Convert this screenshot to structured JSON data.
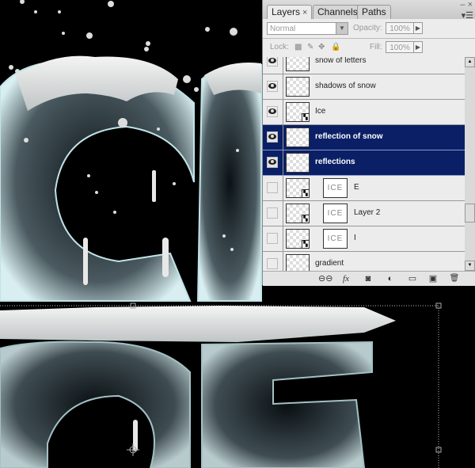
{
  "canvas": {
    "description": "Snow-covered ice letters artwork with reflection on black background",
    "background_color": "#000000"
  },
  "layers_panel": {
    "tabs": [
      {
        "label": "Layers",
        "close": "×",
        "active": true
      },
      {
        "label": "Channels",
        "active": false
      },
      {
        "label": "Paths",
        "active": false
      }
    ],
    "window_controls": {
      "minimize": "–",
      "close": "×"
    },
    "menu_icon": "panel-menu-icon",
    "blend_mode": "Normal",
    "opacity_label": "Opacity:",
    "opacity_value": "100%",
    "lock_label": "Lock:",
    "fill_label": "Fill:",
    "fill_value": "100%",
    "selection_color": "#0a1f66",
    "layers": [
      {
        "name": "snow of letters",
        "visible": true,
        "selected": false,
        "smart_object": false,
        "mask_text": ""
      },
      {
        "name": "shadows of snow",
        "visible": true,
        "selected": false,
        "smart_object": false,
        "mask_text": ""
      },
      {
        "name": "Ice",
        "visible": true,
        "selected": false,
        "smart_object": true,
        "mask_text": ""
      },
      {
        "name": "reflection of snow",
        "visible": true,
        "selected": true,
        "smart_object": false,
        "mask_text": ""
      },
      {
        "name": "reflections",
        "visible": true,
        "selected": true,
        "smart_object": false,
        "mask_text": ""
      },
      {
        "name": "E",
        "visible": false,
        "selected": false,
        "smart_object": true,
        "mask_text": "ICE"
      },
      {
        "name": "Layer 2",
        "visible": false,
        "selected": false,
        "smart_object": true,
        "mask_text": "ICE"
      },
      {
        "name": "I",
        "visible": false,
        "selected": false,
        "smart_object": true,
        "mask_text": "ICE"
      },
      {
        "name": "gradient",
        "visible": false,
        "selected": false,
        "smart_object": false,
        "mask_text": ""
      }
    ],
    "footer_icons": [
      "link-layers-icon",
      "fx-icon",
      "add-mask-icon",
      "adjustment-layer-icon",
      "new-group-icon",
      "new-layer-icon",
      "delete-layer-icon"
    ],
    "footer_glyphs": {
      "link": "⊖⊖",
      "fx": "fx",
      "mask": "◙",
      "adjust": "◐",
      "group": "▭",
      "new": "▣",
      "trash": "🗑"
    }
  }
}
